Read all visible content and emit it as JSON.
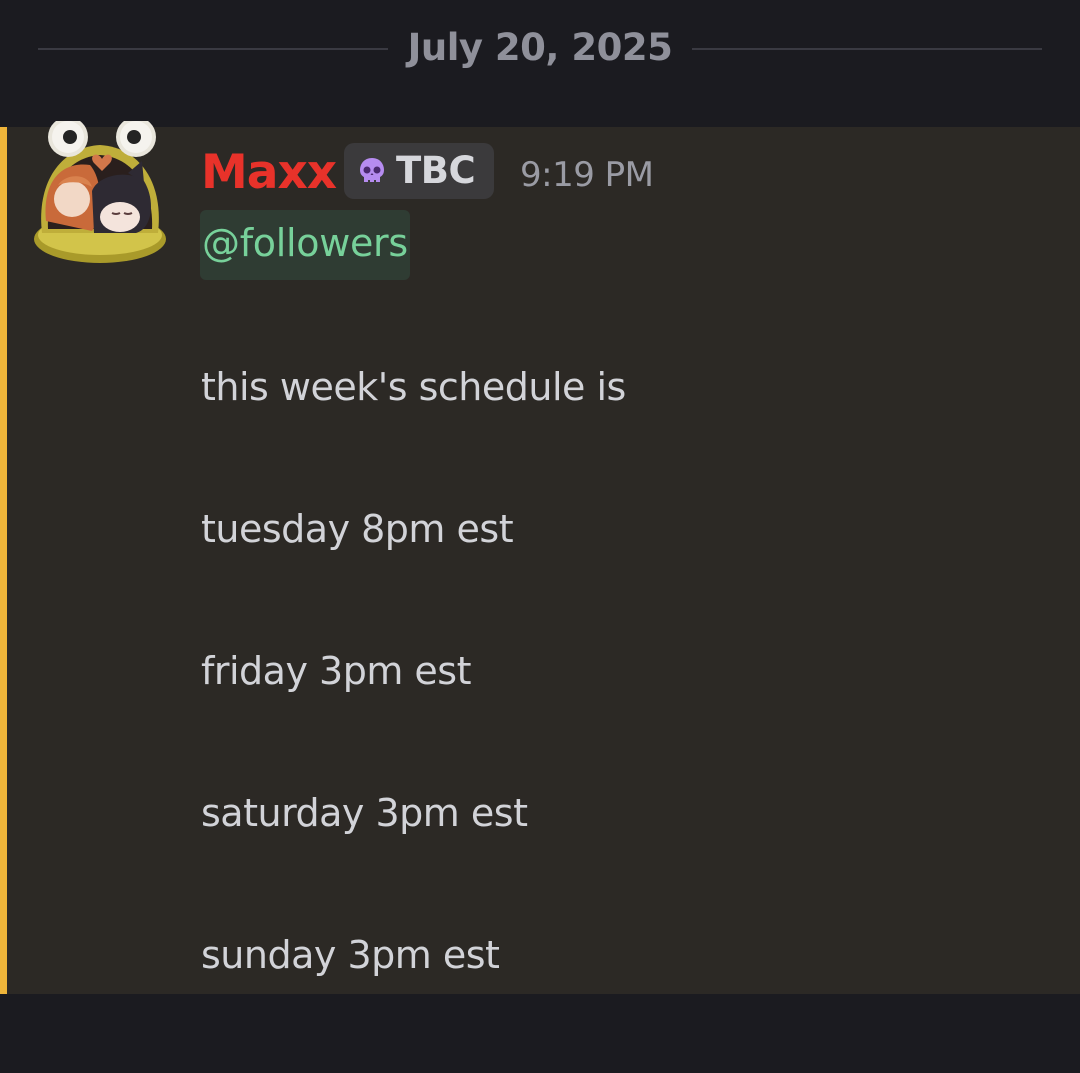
{
  "date_divider": {
    "text": "July 20, 2025"
  },
  "message": {
    "username": "Maxx",
    "tag": {
      "icon": "skull-icon",
      "label": "TBC"
    },
    "timestamp": "9:19 PM",
    "mention": "@followers",
    "lines": [
      "this week's schedule is",
      "tuesday 8pm est",
      "friday 3pm est",
      "saturday 3pm est",
      "sunday 3pm est"
    ],
    "colors": {
      "username": "#e8322a",
      "highlight_bar": "#efb53a",
      "mention_text": "#77d19a",
      "tag_icon": "#b68cf0"
    }
  }
}
